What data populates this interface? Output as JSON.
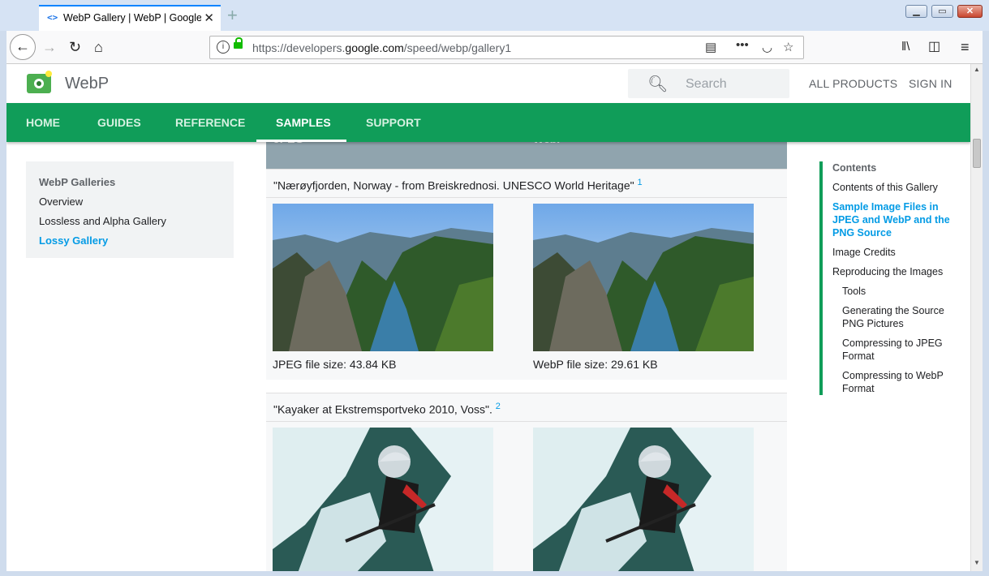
{
  "browser": {
    "tab_title": "WebP Gallery | WebP | Google",
    "tab_favicon": "<>",
    "new_tab_label": "+",
    "url_prefix": "https://developers.",
    "url_domain": "google.com",
    "url_path": "/speed/webp/gallery1",
    "window_buttons": [
      "minimize-icon",
      "maximize-icon",
      "close-icon"
    ],
    "accent_color": "#0a84ff"
  },
  "site": {
    "brand": "WebP",
    "search_placeholder": "Search",
    "all_products": "ALL PRODUCTS",
    "sign_in": "SIGN IN",
    "brand_color": "#109d59"
  },
  "tabs": [
    {
      "label": "HOME"
    },
    {
      "label": "GUIDES"
    },
    {
      "label": "REFERENCE"
    },
    {
      "label": "SAMPLES",
      "active": true
    },
    {
      "label": "SUPPORT"
    }
  ],
  "leftnav": {
    "heading": "WebP Galleries",
    "items": [
      "Overview",
      "Lossless and Alpha Gallery",
      "Lossy Gallery"
    ],
    "active_index": 2
  },
  "table": {
    "col1": "JPEG",
    "col2": "WebP",
    "rows": [
      {
        "caption": "\"Nærøyfjorden, Norway - from Breiskrednosi. UNESCO World Heritage\"",
        "footnote": "1",
        "jpeg_size": "JPEG file size: 43.84 KB",
        "webp_size": "WebP file size: 29.61 KB"
      },
      {
        "caption": "\"Kayaker at Ekstremsportveko 2010, Voss\".",
        "footnote": "2"
      }
    ]
  },
  "toc": {
    "heading": "Contents",
    "items": [
      {
        "label": "Contents of this Gallery"
      },
      {
        "label": "Sample Image Files in JPEG and WebP and the PNG Source",
        "active": true
      },
      {
        "label": "Image Credits"
      },
      {
        "label": "Reproducing the Images"
      },
      {
        "label": "Tools"
      },
      {
        "label": "Generating the Source PNG Pictures"
      },
      {
        "label": "Compressing to JPEG Format"
      },
      {
        "label": "Compressing to WebP Format"
      }
    ]
  }
}
